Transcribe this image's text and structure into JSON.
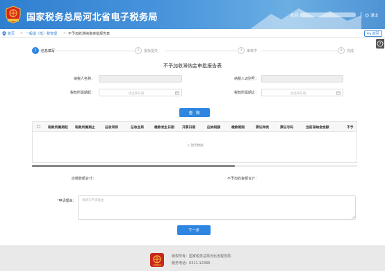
{
  "header": {
    "site_title": "国家税务总局河北省电子税务局",
    "welcome": "欢迎，",
    "logout": "退出",
    "logo_text": "中国税务"
  },
  "breadcrumb": {
    "items": [
      "首页",
      "一般退（抵）税管理",
      "不予加收滞纳金审批报告表"
    ]
  },
  "back_label": "返回",
  "steps": [
    {
      "num": "1",
      "label": "信息填写",
      "state": "active"
    },
    {
      "num": "2",
      "label": "报批提交",
      "state": "idle"
    },
    {
      "num": "3",
      "label": "审核中",
      "state": "idle"
    },
    {
      "num": "4",
      "label": "完成",
      "state": "idle"
    }
  ],
  "form": {
    "title": "不予加收滞纳金审批报告表",
    "taxpayer_name_label": "纳税人名称：",
    "taxpayer_id_label": "纳税人识别号：",
    "period_start_label": "税款所属期起：",
    "period_end_label": "税款所属期止：",
    "date_placeholder": "请选择日期",
    "query_label": "查 询"
  },
  "table": {
    "columns": [
      "税款所属期起",
      "税款所属期止",
      "征收项目",
      "征收品目",
      "缴款发生日期",
      "开票日期",
      "应纳税额",
      "缴款期限",
      "票证种类",
      "票证号码",
      "当前滞纳金金额",
      "不予"
    ],
    "empty_text": "暂无数据"
  },
  "totals": {
    "overdue_amount_label": "应缴数额合计：",
    "waived_late_fee_label": "不予加收金额合计："
  },
  "reason": {
    "label": "申请理由：",
    "required_mark": "*",
    "placeholder": "请填写申请理由"
  },
  "next_label": "下一步",
  "footer": {
    "copyright": "版权所有：国家税务总局河北省税务局",
    "hotline": "服务电话：0311-12366"
  },
  "colors": {
    "primary": "#2e86e0",
    "header_gradient_start": "#2f7fd0",
    "footer_bg": "#e9e9e9"
  }
}
